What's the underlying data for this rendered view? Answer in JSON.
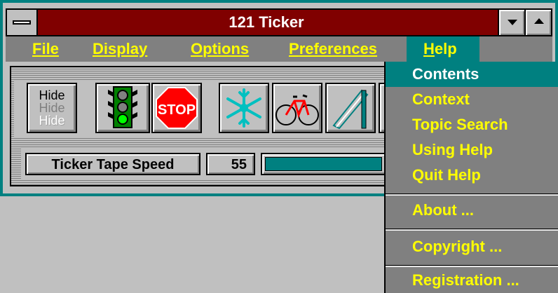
{
  "window": {
    "title": "121 Ticker"
  },
  "menubar": {
    "items": [
      {
        "label_u": "F",
        "label_rest": "ile"
      },
      {
        "label_u": "D",
        "label_rest": "isplay"
      },
      {
        "label_u": "O",
        "label_rest": "ptions"
      },
      {
        "label_u": "P",
        "label_rest": "references"
      },
      {
        "label_u": "H",
        "label_rest": "elp"
      }
    ],
    "active": "Help"
  },
  "toolbar": {
    "hide_lines": [
      "Hide",
      "Hide",
      "Hide"
    ],
    "stop_label": "STOP",
    "icons": [
      "hide-icon",
      "traffic-light-icon",
      "stop-sign-icon",
      "snowflake-icon",
      "bicycle-icon",
      "slide-icon"
    ]
  },
  "speed": {
    "label": "Ticker Tape Speed",
    "value": "55",
    "fill_fraction": 0.95
  },
  "help_menu": {
    "group1": [
      "Contents",
      "Context",
      "Topic Search",
      "Using Help",
      "Quit Help"
    ],
    "about": "About ...",
    "copyright": "Copyright ...",
    "registration": "Registration ...",
    "highlighted": "Contents"
  },
  "colors": {
    "title_bar": "#800000",
    "menubar": "#808080",
    "menu_text": "#ffff00",
    "highlight": "#008080",
    "face": "#c0c0c0"
  }
}
